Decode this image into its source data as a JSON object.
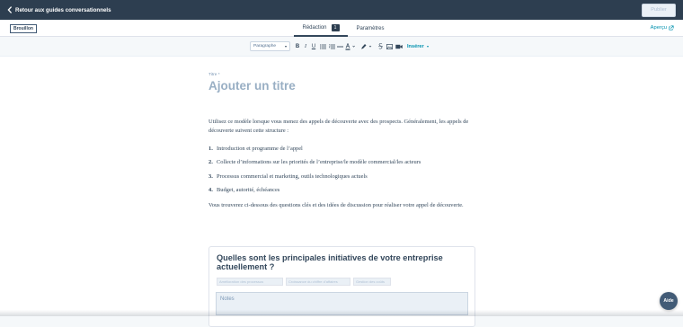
{
  "header": {
    "back_label": "Retour aux guides conversationnels",
    "publish_label": "Publier"
  },
  "subbar": {
    "status_badge": "Brouillon",
    "tabs": [
      {
        "label": "Rédaction",
        "count": "1"
      },
      {
        "label": "Paramètres"
      }
    ],
    "preview_label": "Aperçu"
  },
  "toolbar": {
    "paragraph_select": "Paragraphe",
    "bold": "B",
    "italic": "I",
    "underline": "U",
    "insert_label": "Insérer"
  },
  "editor": {
    "title_label": "Titre *",
    "title_placeholder": "Ajouter un titre",
    "intro": "Utilisez ce modèle lorsque vous menez des appels de découverte avec des prospects. Généralement, les appels de découverte suivent cette structure :",
    "steps": [
      {
        "num": "1.",
        "text": "Introduction et programme de l’appel"
      },
      {
        "num": "2.",
        "text": "Collecte d’informations sur les priorités de l’entreprise/le modèle commercial/les acteurs"
      },
      {
        "num": "3.",
        "text": "Processus commercial et marketing, outils technologiques actuels"
      },
      {
        "num": "4.",
        "text": "Budget, autorité, échéances"
      }
    ],
    "outro": "Vous trouverez ci-dessous des questions clés et des idées de discussion pour réaliser votre appel de découverte."
  },
  "card": {
    "question": "Quelles sont les principales initiatives de votre entreprise actuellement ?",
    "chips": [
      "Amélioration des processus",
      "Croissance du chiffre d’affaires",
      "Gestion des coûts"
    ],
    "notes_placeholder": "Notes"
  },
  "help_label": "Aide",
  "colors": {
    "topbar": "#2d3e50",
    "accent": "#0091ae",
    "text": "#33475b"
  }
}
